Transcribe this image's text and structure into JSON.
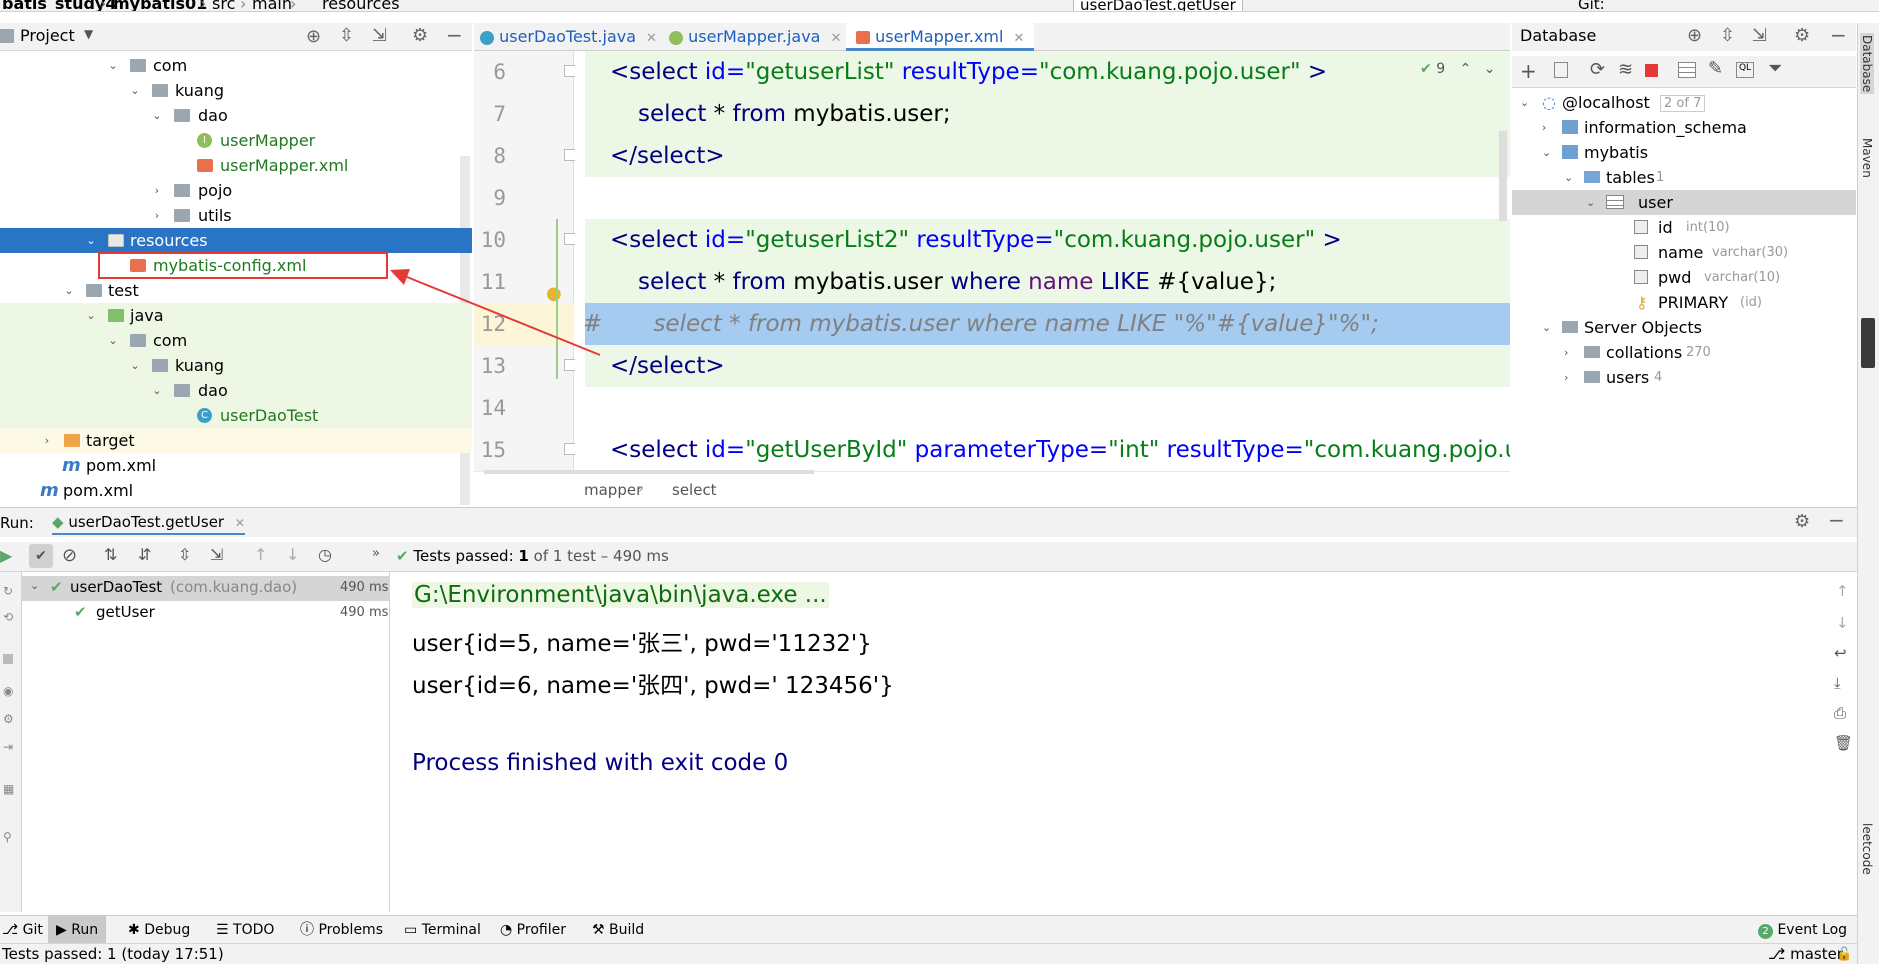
{
  "topbar": {
    "crumbs": [
      "batis_study4",
      "mybatis01",
      "src",
      "main",
      "resources"
    ],
    "run_config": "userDaoTest.getUser",
    "git_label": "Git:"
  },
  "project": {
    "title": "Project",
    "tree": [
      {
        "label": "com",
        "kind": "folder"
      },
      {
        "label": "kuang",
        "kind": "package"
      },
      {
        "label": "dao",
        "kind": "package"
      },
      {
        "label": "userMapper",
        "kind": "interface"
      },
      {
        "label": "userMapper.xml",
        "kind": "xml"
      },
      {
        "label": "pojo",
        "kind": "package"
      },
      {
        "label": "utils",
        "kind": "package"
      },
      {
        "label": "resources",
        "kind": "resources"
      },
      {
        "label": "mybatis-config.xml",
        "kind": "xml"
      },
      {
        "label": "test",
        "kind": "folder"
      },
      {
        "label": "java",
        "kind": "folder-green"
      },
      {
        "label": "com",
        "kind": "package"
      },
      {
        "label": "kuang",
        "kind": "package"
      },
      {
        "label": "dao",
        "kind": "package"
      },
      {
        "label": "userDaoTest",
        "kind": "class"
      },
      {
        "label": "target",
        "kind": "folder-orange"
      },
      {
        "label": "pom.xml",
        "kind": "maven"
      },
      {
        "label": "pom.xml",
        "kind": "maven"
      }
    ]
  },
  "editor": {
    "tabs": [
      {
        "label": "userDaoTest.java",
        "icon": "class-icon"
      },
      {
        "label": "userMapper.java",
        "icon": "interface-icon"
      },
      {
        "label": "userMapper.xml",
        "icon": "xml-icon"
      }
    ],
    "inspection_count": "9",
    "line_numbers": [
      "6",
      "7",
      "8",
      "9",
      "10",
      "11",
      "12",
      "13",
      "14",
      "15"
    ],
    "lines": {
      "l6_tag": "<select",
      "l6_attr1": " id=",
      "l6_val1": "\"getuserList\"",
      "l6_attr2": " resultType=",
      "l6_val2": "\"com.kuang.pojo.user\"",
      "l6_end": " >",
      "l7_kw1": "select",
      "l7_rest1": " * ",
      "l7_kw2": "from",
      "l7_rest2": " mybatis.user;",
      "l8": "</select>",
      "l10_tag": "<select",
      "l10_attr1": " id=",
      "l10_val1": "\"getuserList2\"",
      "l10_attr2": " resultType=",
      "l10_val2": "\"com.kuang.pojo.user\"",
      "l10_end": " >",
      "l11_kw1": "select",
      "l11_rest1": " * ",
      "l11_kw2": "from",
      "l11_rest2": " mybatis.user ",
      "l11_kw3": "where",
      "l11_col": " name ",
      "l11_kw4": "LIKE",
      "l11_rest3": " #{value};",
      "l12": "#       select * from mybatis.user where name LIKE \"%\"#{value}\"%\";",
      "l13": "</select>",
      "l15_tag": "<select",
      "l15_attr1": " id=",
      "l15_val1": "\"getUserById\"",
      "l15_attr2": " parameterType=",
      "l15_val2": "\"int\"",
      "l15_attr3": " resultType=",
      "l15_val3": "\"com.kuang.pojo.u"
    },
    "breadcrumb": [
      "mapper",
      "select"
    ]
  },
  "database": {
    "title": "Database",
    "tree": [
      {
        "label": "@localhost",
        "extra": "2 of 7"
      },
      {
        "label": "information_schema",
        "extra": ""
      },
      {
        "label": "mybatis",
        "extra": ""
      },
      {
        "label": "tables",
        "extra": "1"
      },
      {
        "label": "user",
        "extra": ""
      },
      {
        "label": "id",
        "extra": "int(10)"
      },
      {
        "label": "name",
        "extra": "varchar(30)"
      },
      {
        "label": "pwd",
        "extra": "varchar(10)"
      },
      {
        "label": "PRIMARY",
        "extra": "(id)"
      },
      {
        "label": "Server Objects",
        "extra": ""
      },
      {
        "label": "collations",
        "extra": "270"
      },
      {
        "label": "users",
        "extra": "4"
      }
    ]
  },
  "right_stripe": [
    "Database",
    "Maven",
    "leetcode"
  ],
  "run": {
    "label": "Run:",
    "tab": "userDaoTest.getUser",
    "tests_passed_label": "Tests passed:",
    "tests_passed_count": "1",
    "tests_passed_detail": "of 1 test – 490 ms",
    "test_tree": [
      {
        "label": "userDaoTest",
        "package": "(com.kuang.dao)",
        "time": "490 ms"
      },
      {
        "label": "getUser",
        "package": "",
        "time": "490 ms"
      }
    ],
    "console": [
      "G:\\Environment\\java\\bin\\java.exe ...",
      "user{id=5, name='张三', pwd='11232'}",
      "user{id=6, name='张四', pwd=' 123456'}",
      "",
      "Process finished with exit code 0"
    ]
  },
  "tool_windows": [
    "Git",
    "Run",
    "Debug",
    "TODO",
    "Problems",
    "Terminal",
    "Profiler",
    "Build"
  ],
  "event_log": {
    "count": "2",
    "label": "Event Log"
  },
  "status": {
    "message": "Tests passed: 1 (today 17:51)",
    "branch": "master"
  },
  "colors": {
    "selection": "#2a74c6",
    "annotation_red": "#e53935",
    "test_green": "#59a869"
  }
}
